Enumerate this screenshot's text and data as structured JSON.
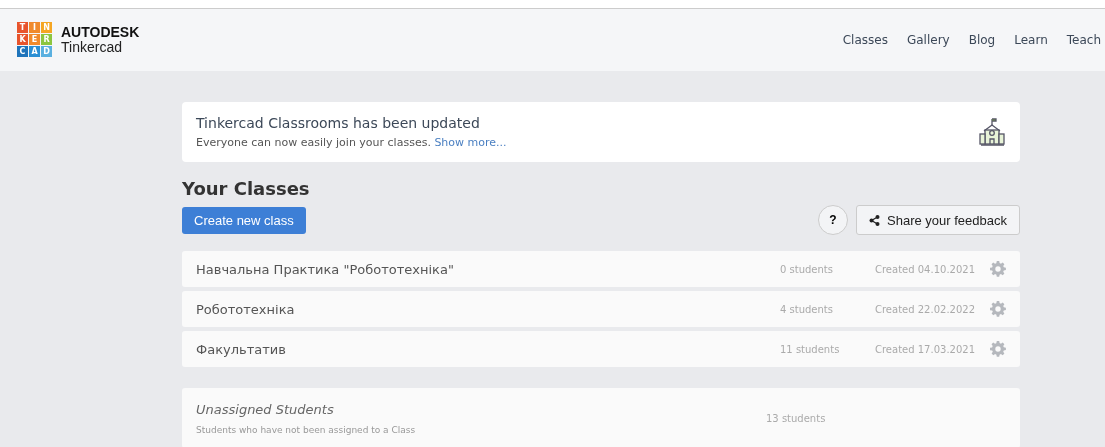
{
  "logo": {
    "letters": [
      "T",
      "I",
      "N",
      "K",
      "E",
      "R",
      "C",
      "A",
      "D"
    ],
    "brand": "AUTODESK",
    "product": "Tinkercad"
  },
  "nav": [
    {
      "label": "Classes"
    },
    {
      "label": "Gallery"
    },
    {
      "label": "Blog"
    },
    {
      "label": "Learn"
    },
    {
      "label": "Teach"
    }
  ],
  "banner": {
    "title": "Tinkercad Classrooms has been updated",
    "text": "Everyone can now easily join your classes.",
    "link": "Show more..."
  },
  "heading": "Your Classes",
  "create_button": "Create new class",
  "help_button": "?",
  "feedback_button": "Share your feedback",
  "classes": [
    {
      "name": "Навчальна Практика \"Робототехніка\"",
      "students": "0 students",
      "created": "Created 04.10.2021"
    },
    {
      "name": "Робототехніка",
      "students": "4 students",
      "created": "Created 22.02.2022"
    },
    {
      "name": "Факультатив",
      "students": "11 students",
      "created": "Created 17.03.2021"
    }
  ],
  "unassigned": {
    "title": "Unassigned Students",
    "subtitle": "Students who have not been assigned to a Class",
    "students": "13 students"
  }
}
